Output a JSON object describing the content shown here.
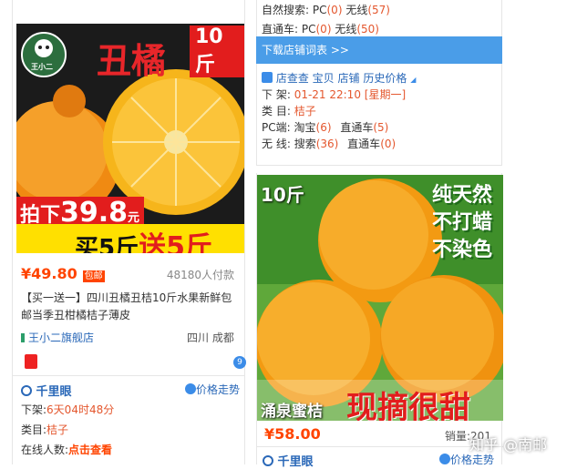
{
  "right_info": {
    "natural_search": {
      "label": "自然搜索:",
      "pc": "PC",
      "pc_val": "(0)",
      "wireless": "无线",
      "wireless_val": "(57)"
    },
    "ztc": {
      "label": "直通车:",
      "pc": "PC",
      "pc_val": "(0)",
      "wireless": "无线",
      "wireless_val": "(50)"
    },
    "download_link": "下载店铺词表 >>",
    "tools": [
      "店查查",
      "宝贝",
      "店铺",
      "历史价格"
    ],
    "offshelf": {
      "label": "下 架:",
      "value": "01-21 22:10 [星期一]"
    },
    "category": {
      "label": "类 目:",
      "value": "桔子"
    },
    "pc_side": {
      "label": "PC端:",
      "taobao": "淘宝",
      "taobao_val": "(6)",
      "ztc": "直通车",
      "ztc_val": "(5)"
    },
    "wireless_side": {
      "label": "无 线:",
      "search": "搜索",
      "search_val": "(36)",
      "ztc": "直通车",
      "ztc_val": "(0)"
    }
  },
  "card1": {
    "brand_logo": "王小二",
    "img_title": "丑橘",
    "img_weight": "10斤",
    "img_promo_prefix": "拍下",
    "img_promo_price": "39.8",
    "img_promo_unit": "元",
    "img_buy": "买5斤",
    "img_give": "送5斤",
    "price": "¥49.80",
    "badge": "包邮",
    "sold": "48180人付款",
    "title": "【买一送一】四川丑橘丑桔10斤水果新鲜包邮当季丑柑橘桔子薄皮",
    "shop": "王小二旗舰店",
    "location": "四川 成都",
    "qianliyan": "千里眼",
    "trend": "价格走势",
    "offshelf_label": "下架:",
    "offshelf_value": "6天04时48分",
    "cat_label": "类目:",
    "cat_value": "桔子",
    "online_label": "在线人数:",
    "online_value": "点击查看"
  },
  "card2": {
    "img_weight": "10斤",
    "img_badges": [
      "纯天然",
      "不打蜡",
      "不染色"
    ],
    "img_name": "涌泉蜜桔",
    "img_slogan": "现摘很甜",
    "price": "¥58.00",
    "sold_label": "销量:",
    "sold_value": "201",
    "qianliyan": "千里眼",
    "trend": "价格走势"
  },
  "watermark": "知乎 @南邮",
  "colors": {
    "accent": "#ff4400",
    "link": "#2a68b8",
    "download_bar": "#4a9de8"
  }
}
